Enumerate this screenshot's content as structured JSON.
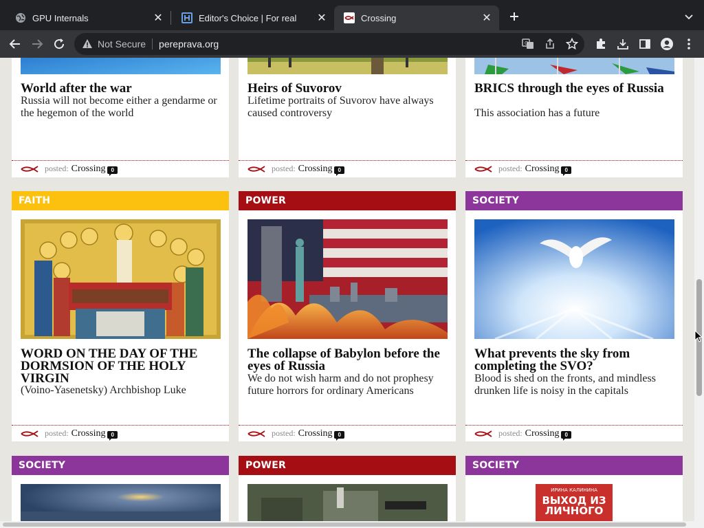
{
  "browser": {
    "tabs": [
      {
        "title": "GPU Internals",
        "icon": "globe-icon"
      },
      {
        "title": "Editor's Choice | For real",
        "icon": "h-logo-icon"
      },
      {
        "title": "Crossing",
        "icon": "fish-icon",
        "active": true
      }
    ],
    "security_label": "Not Secure",
    "url": "pereprava.org"
  },
  "colors": {
    "faith": "#fcc10f",
    "power": "#a50f13",
    "society": "#8c359a"
  },
  "posted_label": "posted:",
  "author": "Crossing",
  "comment_count": "0",
  "rows": [
    {
      "cards": [
        {
          "title": "World after the war",
          "desc": "Russia will not become either a gendarme or the hegemon of the world"
        },
        {
          "title": "Heirs of Suvorov",
          "desc": "Lifetime portraits of Suvorov have always caused controversy"
        },
        {
          "title": "BRICS through the eyes of Russia",
          "desc": "This association has a future"
        }
      ]
    },
    {
      "cards": [
        {
          "category": "FAITH",
          "title": "WORD ON THE DAY OF THE DORMSION OF THE HOLY VIRGIN",
          "desc": "(Voino-Yasenetsky) Archbishop Luke"
        },
        {
          "category": "POWER",
          "title": "The collapse of Babylon before the eyes of Russia",
          "desc": "We do not wish harm and do not prophesy future horrors for ordinary Americans"
        },
        {
          "category": "SOCIETY",
          "title": "What prevents the sky from completing the SVO?",
          "desc": "Blood is shed on the fronts, and mindless drunken life is noisy in the capitals"
        }
      ]
    },
    {
      "cards": [
        {
          "category": "SOCIETY"
        },
        {
          "category": "POWER"
        },
        {
          "category": "SOCIETY",
          "book_author": "ИРИНА КАЛИНИНА",
          "book_title": "ВЫХОД ИЗ ЛИЧНОГО"
        }
      ]
    }
  ]
}
